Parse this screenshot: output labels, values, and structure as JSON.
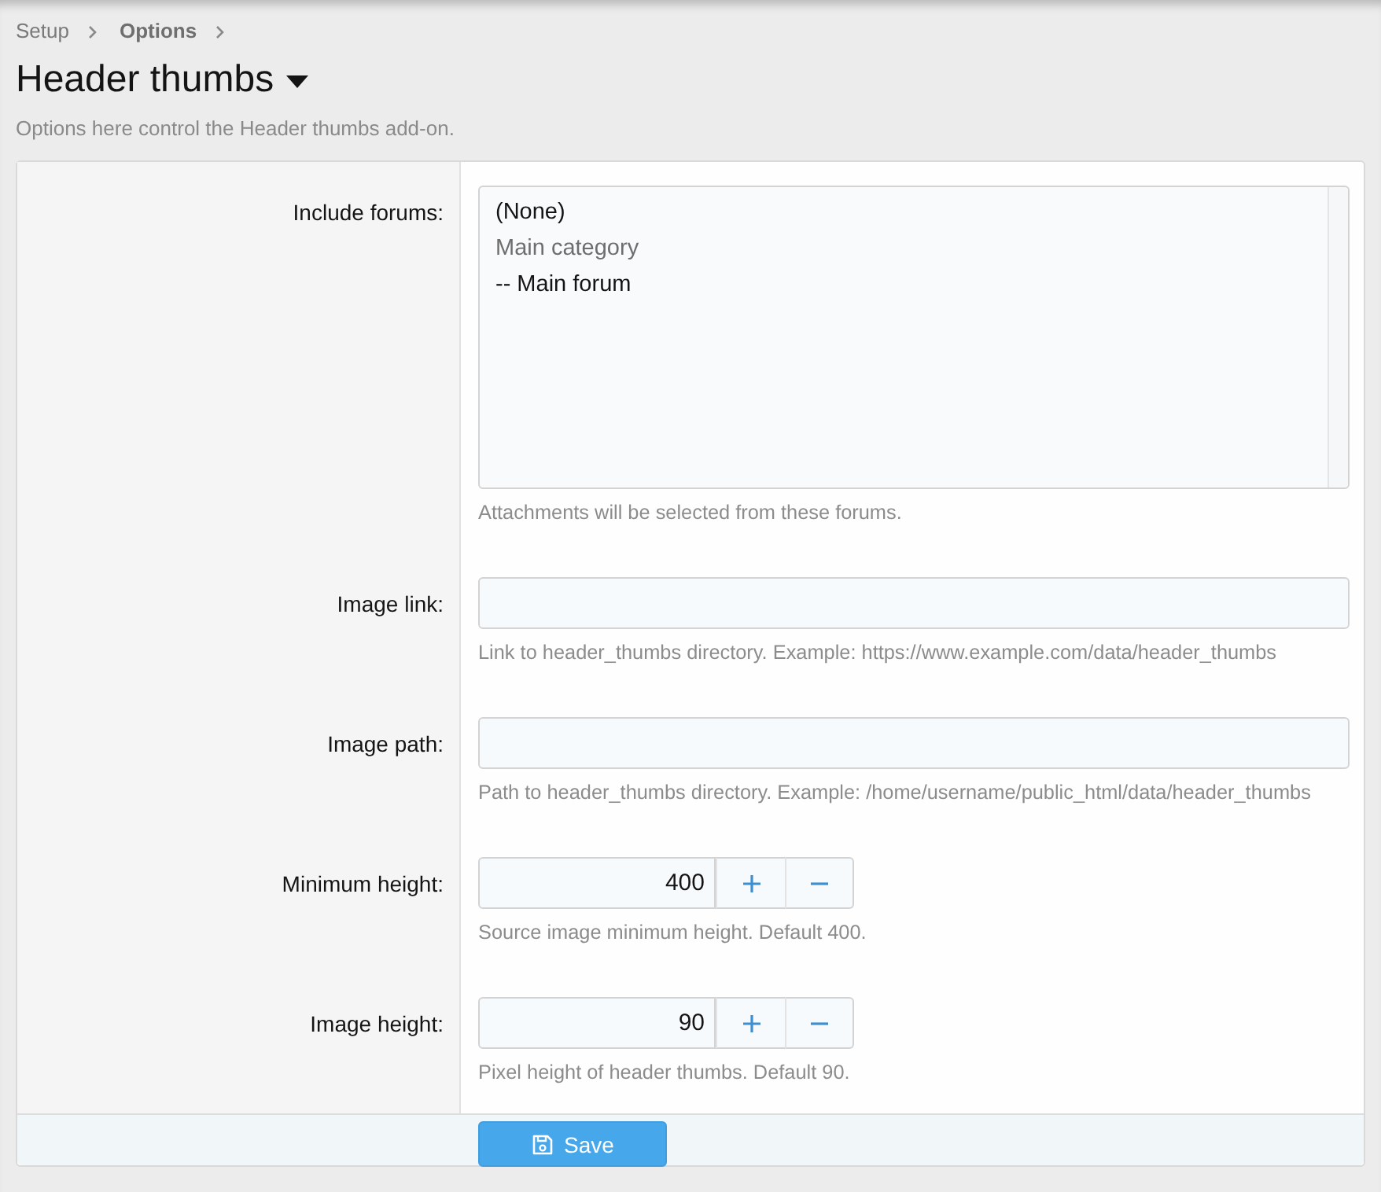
{
  "breadcrumb": [
    {
      "label": "Setup",
      "current": false
    },
    {
      "label": "Options",
      "current": true
    }
  ],
  "header": {
    "title": "Header thumbs",
    "description": "Options here control the Header thumbs add-on."
  },
  "fields": [
    {
      "kind": "listbox",
      "label": "Include forums:",
      "options": [
        {
          "label": "(None)",
          "disabled": false
        },
        {
          "label": "Main category",
          "disabled": true
        },
        {
          "label": "-- Main forum",
          "disabled": false
        }
      ],
      "hint": "Attachments will be selected from these forums."
    },
    {
      "kind": "text",
      "label": "Image link:",
      "hint": "Link to header_thumbs directory. Example: https://www.example.com/data/header_thumbs"
    },
    {
      "kind": "text",
      "label": "Image path:",
      "hint": "Path to header_thumbs directory. Example: /home/username/public_html/data/header_thumbs"
    },
    {
      "kind": "number",
      "label": "Minimum height:",
      "value": "400",
      "hint": "Source image minimum height. Default 400."
    },
    {
      "kind": "number",
      "label": "Image height:",
      "value": "90",
      "hint": "Pixel height of header thumbs. Default 90."
    }
  ],
  "save_button": {
    "label": "Save"
  }
}
